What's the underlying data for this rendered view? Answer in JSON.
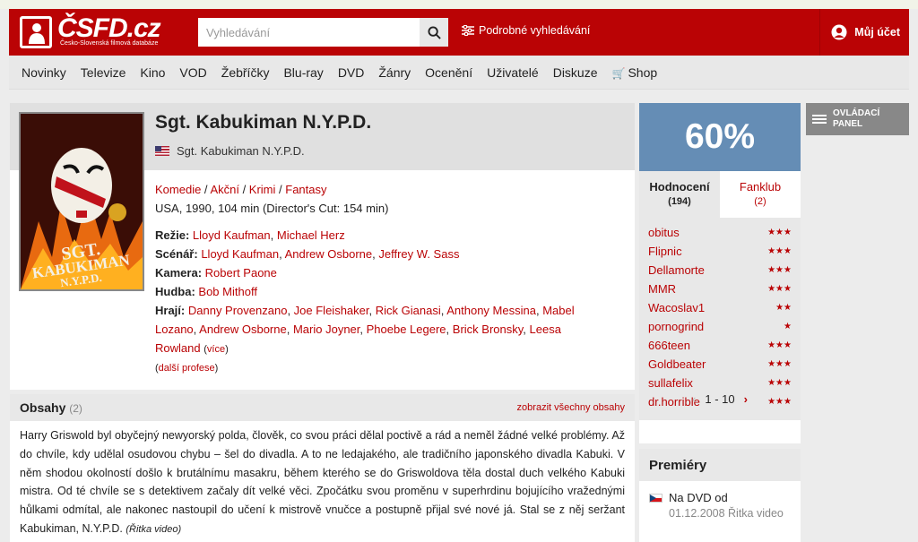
{
  "header": {
    "logo_text": "ČSFD.cz",
    "logo_sub": "Česko-Slovenská filmová databáze",
    "search_placeholder": "Vyhledávání",
    "advanced_search": "Podrobné vyhledávání",
    "account": "Můj účet",
    "brand_color": "#ba0305"
  },
  "nav": [
    "Novinky",
    "Televize",
    "Kino",
    "VOD",
    "Žebříčky",
    "Blu-ray",
    "DVD",
    "Žánry",
    "Ocenění",
    "Uživatelé",
    "Diskuze",
    "Shop"
  ],
  "film": {
    "title": "Sgt. Kabukiman N.Y.P.D.",
    "original_title": "Sgt. Kabukiman N.Y.P.D.",
    "genres": [
      "Komedie",
      "Akční",
      "Krimi",
      "Fantasy"
    ],
    "origin": "USA, 1990, 104 min (Director's Cut: 154 min)",
    "credits": {
      "directing_label": "Režie:",
      "directing": [
        "Lloyd Kaufman",
        "Michael Herz"
      ],
      "writing_label": "Scénář:",
      "writing": [
        "Lloyd Kaufman",
        "Andrew Osborne",
        "Jeffrey W. Sass"
      ],
      "camera_label": "Kamera:",
      "camera": [
        "Robert Paone"
      ],
      "music_label": "Hudba:",
      "music": [
        "Bob Mithoff"
      ],
      "cast_label": "Hrají:",
      "cast": [
        "Danny Provenzano",
        "Joe Fleishaker",
        "Rick Gianasi",
        "Anthony Messina",
        "Mabel Lozano",
        "Andrew Osborne",
        "Mario Joyner",
        "Phoebe Legere",
        "Brick Bronsky",
        "Leesa Rowland"
      ],
      "more_cast": "více",
      "more_professions": "další profese"
    }
  },
  "plots": {
    "title": "Obsahy",
    "count": "(2)",
    "show_all": "zobrazit všechny obsahy",
    "text": "Harry Griswold byl obyčejný newyorský polda, člověk, co svou práci dělal poctivě a rád a neměl žádné velké problémy. Až do chvíle, kdy udělal osudovou chybu – šel do divadla. A to ne ledajakého, ale tradičního japonského divadla Kabuki. V něm shodou okolností došlo k brutálnímu masakru, během kterého se do Griswoldova těla dostal duch velkého Kabuki mistra. Od té chvíle se s detektivem začaly dít velké věci. Zpočátku svou proměnu v superhrdinu bojujícího vražednými hůlkami odmítal, ale nakonec nastoupil do učení k mistrově vnučce a postupně přijal své nové já. Stal se z něj seržant Kabukiman, N.Y.P.D.",
    "source": "(Řitka video)"
  },
  "rating": {
    "percent": "60%",
    "color": "#658db5",
    "tab_ratings": "Hodnocení",
    "tab_ratings_count": "(194)",
    "tab_fanclub": "Fanklub",
    "tab_fanclub_count": "(2)",
    "users": [
      {
        "name": "obitus",
        "stars": 3
      },
      {
        "name": "Flipnic",
        "stars": 3
      },
      {
        "name": "Dellamorte",
        "stars": 3
      },
      {
        "name": "MMR",
        "stars": 3
      },
      {
        "name": "Wacoslav1",
        "stars": 2
      },
      {
        "name": "pornogrind",
        "stars": 1
      },
      {
        "name": "666teen",
        "stars": 3
      },
      {
        "name": "Goldbeater",
        "stars": 3
      },
      {
        "name": "sullafelix",
        "stars": 3
      },
      {
        "name": "dr.horrible",
        "stars": 3
      }
    ],
    "pager": "1 - 10"
  },
  "premiere": {
    "title": "Premiéry",
    "entry": "Na DVD od",
    "date": "01.12.2008 Řitka video"
  },
  "panel_button": "OVLÁDACÍ PANEL"
}
